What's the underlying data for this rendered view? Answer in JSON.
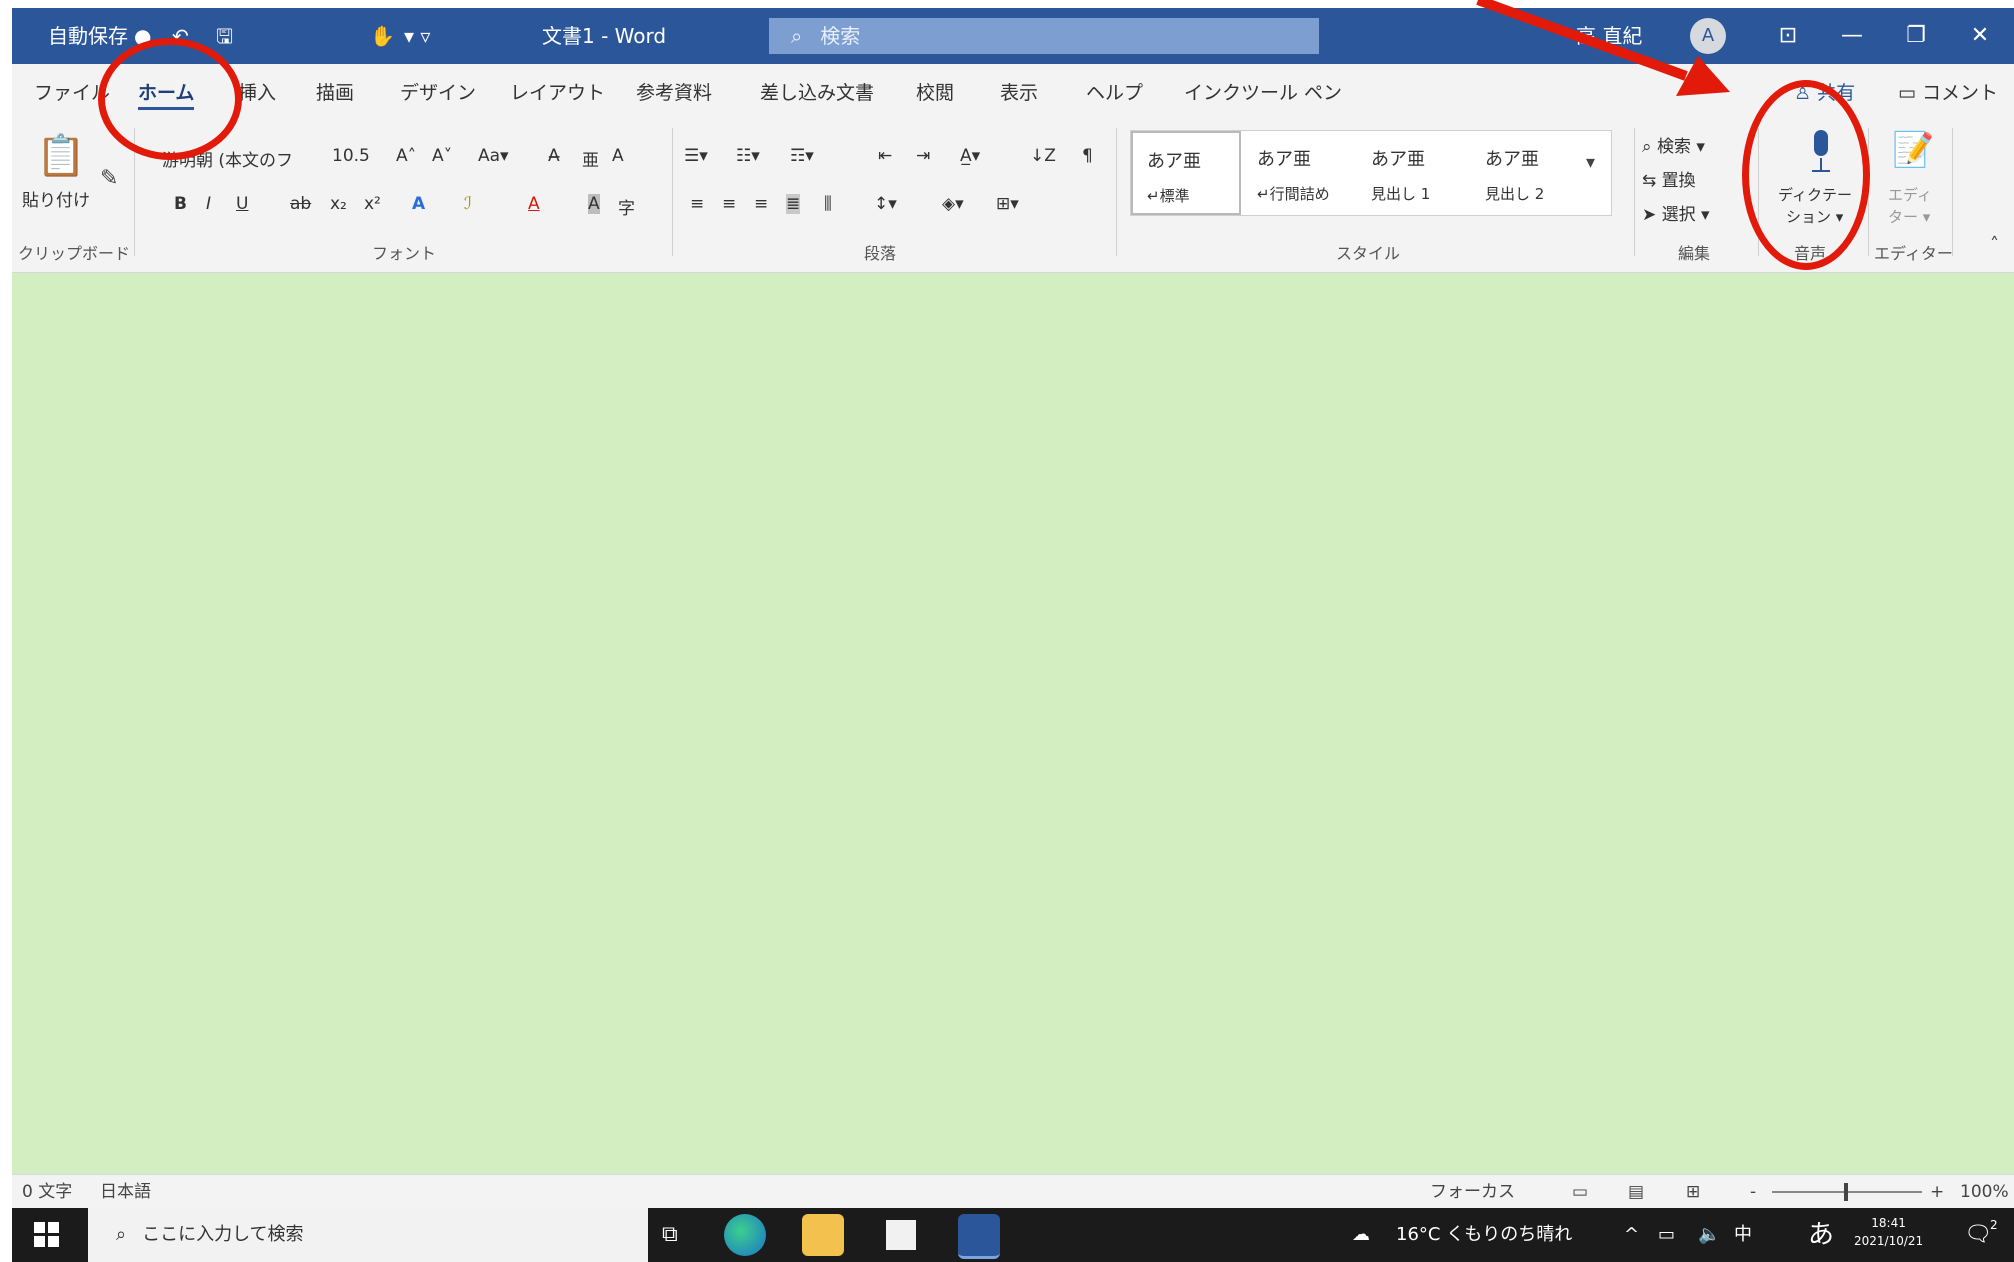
{
  "titlebar": {
    "autosave": "自動保存",
    "autosave_toggle": "●",
    "undo": "↶",
    "save_glyph": "🖫",
    "touch_glyph": "✋",
    "qa_more": "▾ ▿",
    "doc_title": "文書1 - Word",
    "search_placeholder": "検索",
    "user_name": "高  直紀",
    "avatar_letter": "A",
    "ribbon_display": "⊡",
    "minimize": "—",
    "maximize": "❐",
    "close": "✕"
  },
  "tabs": [
    {
      "label": "ファイル"
    },
    {
      "label": "ホーム"
    },
    {
      "label": "挿入"
    },
    {
      "label": "描画"
    },
    {
      "label": "デザイン"
    },
    {
      "label": "レイアウト"
    },
    {
      "label": "参考資料"
    },
    {
      "label": "差し込み文書"
    },
    {
      "label": "校閲"
    },
    {
      "label": "表示"
    },
    {
      "label": "ヘルプ"
    },
    {
      "label": "インクツール ペン"
    }
  ],
  "tab_actions": {
    "share": "♙ 共有",
    "comment": "▭ コメント"
  },
  "ribbon": {
    "clipboard": {
      "paste": "貼り付け",
      "label": "クリップボード"
    },
    "font": {
      "name": "游明朝 (本文のフ",
      "size": "10.5",
      "grow": "A˄",
      "shrink": "A˅",
      "case": "Aa▾",
      "clear": "A̶",
      "phonetic": "亜",
      "border": "A",
      "bold": "B",
      "italic": "I",
      "underline": "U",
      "strike": "ab",
      "subscript": "x₂",
      "superscript": "x²",
      "effects": "A",
      "highlight": "ℐ",
      "color": "A",
      "shading": "A",
      "enclosed": "字",
      "label": "フォント"
    },
    "paragraph": {
      "bullets": "☰▾",
      "numbers": "☷▾",
      "multilevel": "☶▾",
      "decrease_indent": "⇤",
      "increase_indent": "⇥",
      "asian_layout": "A̲▾",
      "sort": "↓Z",
      "marks": "¶",
      "align_left": "≡",
      "align_center": "≡",
      "align_right": "≡",
      "justify": "≣",
      "distributed": "⫼",
      "line_spacing": "↕▾",
      "shading": "◈▾",
      "borders": "⊞▾",
      "label": "段落"
    },
    "styles": {
      "items": [
        {
          "preview": "あア亜",
          "name": "↵標準"
        },
        {
          "preview": "あア亜",
          "name": "↵行間詰め"
        },
        {
          "preview": "あア亜",
          "name": "見出し 1"
        },
        {
          "preview": "あア亜",
          "name": "見出し 2"
        }
      ],
      "label": "スタイル"
    },
    "editing": {
      "find": "検索 ▾",
      "replace": "置換",
      "select": "選択 ▾",
      "label": "編集"
    },
    "voice": {
      "dictate": "ディクテー",
      "dictate2": "ション ▾",
      "label": "音声"
    },
    "editor": {
      "name": "エディ",
      "name2": "ター ▾",
      "label": "エディター"
    }
  },
  "status": {
    "words": "0 文字",
    "language": "日本語",
    "focus": "フォーカス",
    "read_mode": "▭",
    "print_layout": "▤",
    "web_layout": "⊞",
    "zoom_minus": "-",
    "zoom_plus": "+",
    "zoom": "100%"
  },
  "taskbar": {
    "search_placeholder": "ここに入力して検索",
    "weather": "16°C くもりのち晴れ",
    "tray_up": "^",
    "tray_net": "▭",
    "tray_vol": "🔈",
    "ime1": "中",
    "ime2": "あ",
    "time": "18:41",
    "date": "2021/10/21",
    "notify": "2"
  }
}
